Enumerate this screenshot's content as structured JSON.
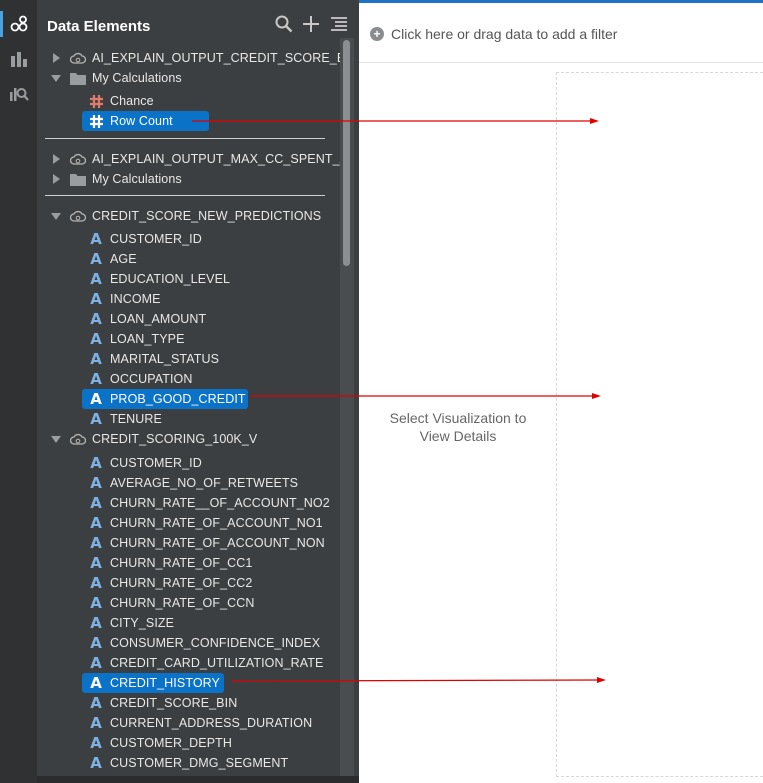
{
  "panel": {
    "title": "Data Elements"
  },
  "filter_bar": {
    "prompt": "Click here or drag data to add a filter"
  },
  "canvas": {
    "placeholder_line1": "Select Visualization to",
    "placeholder_line2": "View Details"
  },
  "tree": {
    "group1": {
      "dataset": "AI_EXPLAIN_OUTPUT_CREDIT_SCORE_BIN",
      "folder": "My Calculations",
      "items": [
        "Chance",
        "Row Count"
      ]
    },
    "group2": {
      "dataset": "AI_EXPLAIN_OUTPUT_MAX_CC_SPENT_AM",
      "folder": "My Calculations"
    },
    "group3": {
      "dataset": "CREDIT_SCORE_NEW_PREDICTIONS",
      "items": [
        "CUSTOMER_ID",
        "AGE",
        "EDUCATION_LEVEL",
        "INCOME",
        "LOAN_AMOUNT",
        "LOAN_TYPE",
        "MARITAL_STATUS",
        "OCCUPATION",
        "PROB_GOOD_CREDIT",
        "TENURE"
      ]
    },
    "group4": {
      "dataset": "CREDIT_SCORING_100K_V",
      "items": [
        "CUSTOMER_ID",
        "AVERAGE_NO_OF_RETWEETS",
        "CHURN_RATE__OF_ACCOUNT_NO2",
        "CHURN_RATE_OF_ACCOUNT_NO1",
        "CHURN_RATE_OF_ACCOUNT_NON",
        "CHURN_RATE_OF_CC1",
        "CHURN_RATE_OF_CC2",
        "CHURN_RATE_OF_CCN",
        "CITY_SIZE",
        "CONSUMER_CONFIDENCE_INDEX",
        "CREDIT_CARD_UTILIZATION_RATE",
        "CREDIT_HISTORY",
        "CREDIT_SCORE_BIN",
        "CURRENT_ADDRESS_DURATION",
        "CUSTOMER_DEPTH",
        "CUSTOMER_DMG_SEGMENT"
      ]
    }
  },
  "colors": {
    "panel_bg": "#3c3f41",
    "rail_bg": "#2f3133",
    "selection": "#0b73c7",
    "attribute_icon": "#7fb1e3",
    "measure_icon": "#e07a6b",
    "annotation_arrow": "#e00000"
  },
  "icons": {
    "rail": [
      "data-elements-icon",
      "visualizations-icon",
      "analytics-icon"
    ],
    "header": [
      "search-icon",
      "add-icon",
      "menu-icon"
    ]
  }
}
